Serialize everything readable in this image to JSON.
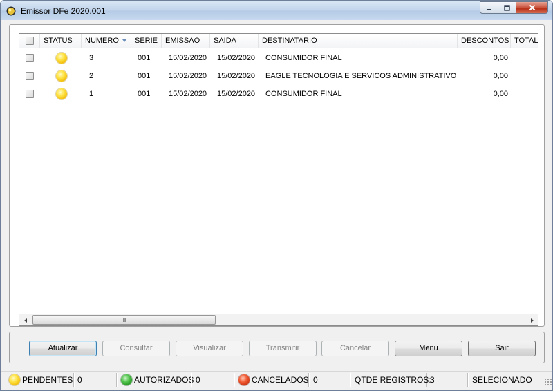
{
  "window": {
    "title": "Emissor DFe 2020.001"
  },
  "grid": {
    "columns": [
      "STATUS",
      "NUMERO",
      "SERIE",
      "EMISSAO",
      "SAIDA",
      "DESTINATARIO",
      "DESCONTOS",
      "TOTAL"
    ],
    "sorted_column": "NUMERO",
    "rows": [
      {
        "status": "yellow",
        "numero": "3",
        "serie": "001",
        "emissao": "15/02/2020",
        "saida": "15/02/2020",
        "destinatario": "CONSUMIDOR FINAL",
        "descontos": "0,00"
      },
      {
        "status": "yellow",
        "numero": "2",
        "serie": "001",
        "emissao": "15/02/2020",
        "saida": "15/02/2020",
        "destinatario": "EAGLE TECNOLOGIA E SERVICOS ADMINISTRATIVOS ...",
        "descontos": "0,00"
      },
      {
        "status": "yellow",
        "numero": "1",
        "serie": "001",
        "emissao": "15/02/2020",
        "saida": "15/02/2020",
        "destinatario": "CONSUMIDOR FINAL",
        "descontos": "0,00"
      }
    ],
    "scroll_thumb_grip": "III"
  },
  "buttons": {
    "atualizar": "Atualizar",
    "consultar": "Consultar",
    "visualizar": "Visualizar",
    "transmitir": "Transmitir",
    "cancelar": "Cancelar",
    "menu": "Menu",
    "sair": "Sair"
  },
  "statusbar": {
    "pendentes_label": "PENDENTES",
    "pendentes_count": "0",
    "autorizados_label": "AUTORIZADOS",
    "autorizados_count": "0",
    "cancelados_label": "CANCELADOS",
    "cancelados_count": "0",
    "qtde_label": "QTDE REGISTROS:",
    "qtde_count": "3",
    "selecionado_label": "SELECIONADO"
  },
  "colors": {
    "pendente": "#f0b800",
    "autorizado": "#1d8a1a",
    "cancelado": "#c02a0a"
  }
}
